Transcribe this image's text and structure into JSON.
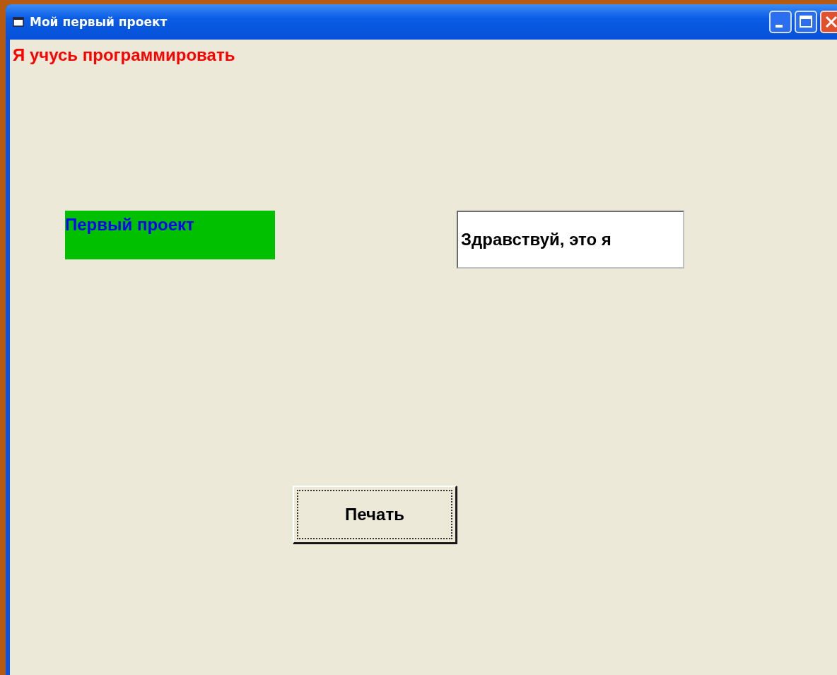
{
  "window": {
    "title": "Мой первый проект"
  },
  "caption_label": {
    "text": "Я учусь программировать"
  },
  "green_label": {
    "text": "Первый проект"
  },
  "text_box": {
    "value": "Здравствуй, это я"
  },
  "print_button": {
    "label": "Печать",
    "focused": true
  }
}
